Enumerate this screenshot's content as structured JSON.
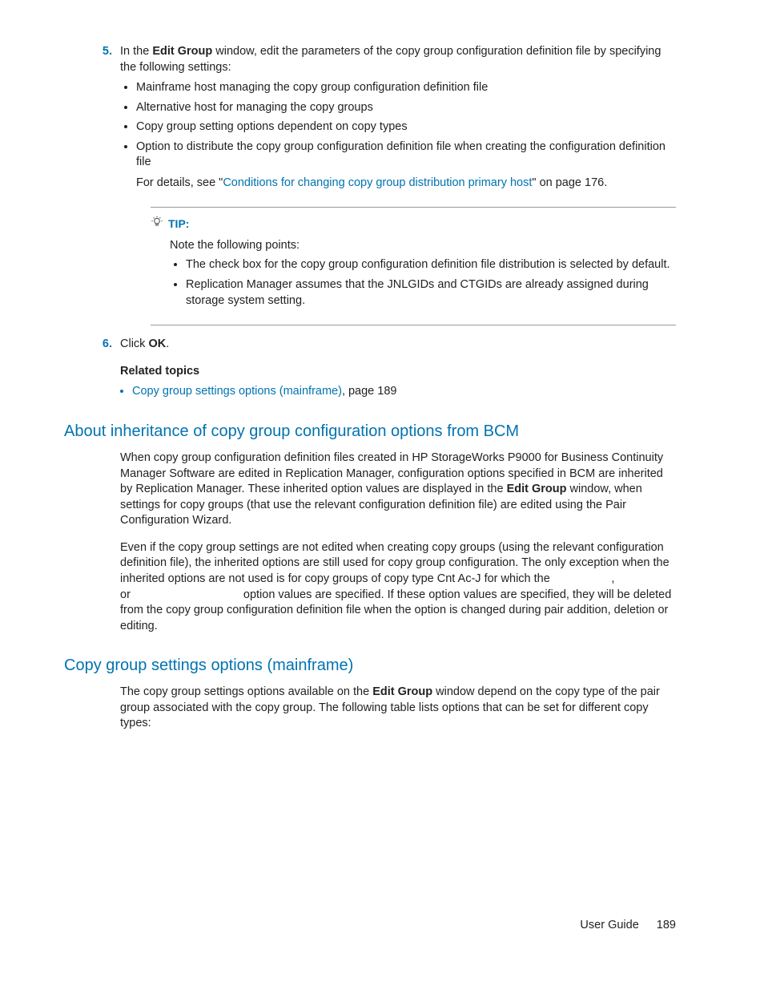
{
  "steps": {
    "s5": {
      "num": "5.",
      "pre": "In the ",
      "bold": "Edit Group",
      "post": " window, edit the parameters of the copy group configuration definition file by specifying the following settings:",
      "items": [
        "Mainframe host managing the copy group configuration definition file",
        "Alternative host for managing the copy groups",
        "Copy group setting options dependent on copy types"
      ],
      "item4a": "Option to distribute the copy group configuration definition file when creating the configuration definition file",
      "item4_pre": "For details, see \"",
      "item4_link": "Conditions for changing copy group distribution primary host",
      "item4_post": "\" on page 176."
    },
    "s6": {
      "num": "6.",
      "pre": "Click ",
      "bold": "OK",
      "post": "."
    }
  },
  "tip": {
    "label": "TIP:",
    "note": "Note the following points:",
    "items": [
      "The check box for the copy group configuration definition file distribution is selected by default.",
      "Replication Manager assumes that the JNLGIDs and CTGIDs are already assigned during storage system setting."
    ]
  },
  "related": {
    "heading": "Related topics",
    "link": "Copy group settings options (mainframe)",
    "after": ", page 189"
  },
  "sec1": {
    "heading": "About inheritance of copy group configuration options from BCM",
    "p1_pre": "When copy group configuration definition files created in HP StorageWorks P9000 for Business Continuity Manager Software are edited in Replication Manager, configuration options specified in BCM are inherited by Replication Manager. These inherited option values are displayed in the ",
    "p1_bold": "Edit Group",
    "p1_post": " window, when settings for copy groups (that use the relevant configuration definition file) are edited using the Pair Configuration Wizard.",
    "p2": "Even if the copy group settings are not edited when creating copy groups (using the relevant configuration definition file), the inherited options are still used for copy group configuration. The only exception when the inherited options are not used is for copy groups of copy type Cnt Ac-J for which the                   ,                              or                                   option values are specified. If these option values are specified, they will be deleted from the copy group configuration definition file when the option is changed during pair addition, deletion or editing."
  },
  "sec2": {
    "heading": "Copy group settings options (mainframe)",
    "p1_pre": "The copy group settings options available on the ",
    "p1_bold": "Edit Group",
    "p1_post": " window depend on the copy type of the pair group associated with the copy group. The following table lists options that can be set for different copy types:"
  },
  "footer": {
    "label": "User Guide",
    "page": "189"
  }
}
